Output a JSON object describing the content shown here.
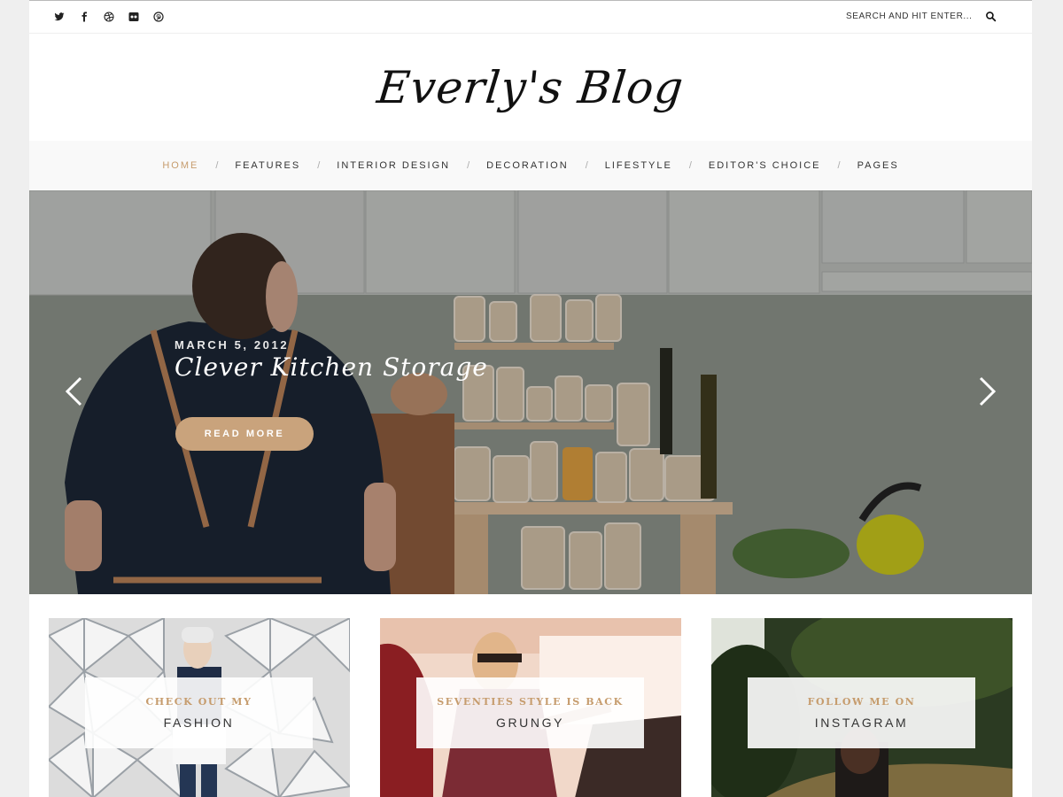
{
  "colors": {
    "accent": "#c69c6d",
    "button": "#c9a37c",
    "text": "#333333",
    "nav_bg": "#f9f9f9"
  },
  "social": [
    {
      "icon": "twitter-icon"
    },
    {
      "icon": "facebook-icon"
    },
    {
      "icon": "dribbble-icon"
    },
    {
      "icon": "flickr-icon"
    },
    {
      "icon": "pinterest-icon"
    }
  ],
  "search": {
    "placeholder": "SEARCH AND HIT ENTER...",
    "icon": "search-icon"
  },
  "logo": {
    "text": "Everly's Blog"
  },
  "nav": {
    "items": [
      "HOME",
      "FEATURES",
      "INTERIOR DESIGN",
      "DECORATION",
      "LIFESTYLE",
      "EDITOR'S CHOICE",
      "PAGES"
    ],
    "active": "HOME"
  },
  "hero": {
    "date": "MARCH 5, 2012",
    "title": "Clever Kitchen Storage",
    "button": "READ MORE"
  },
  "promos": [
    {
      "sub": "CHECK OUT MY",
      "main": "FASHION"
    },
    {
      "sub": "SEVENTIES STYLE IS BACK",
      "main": "GRUNGY"
    },
    {
      "sub": "FOLLOW ME ON",
      "main": "INSTAGRAM"
    }
  ]
}
